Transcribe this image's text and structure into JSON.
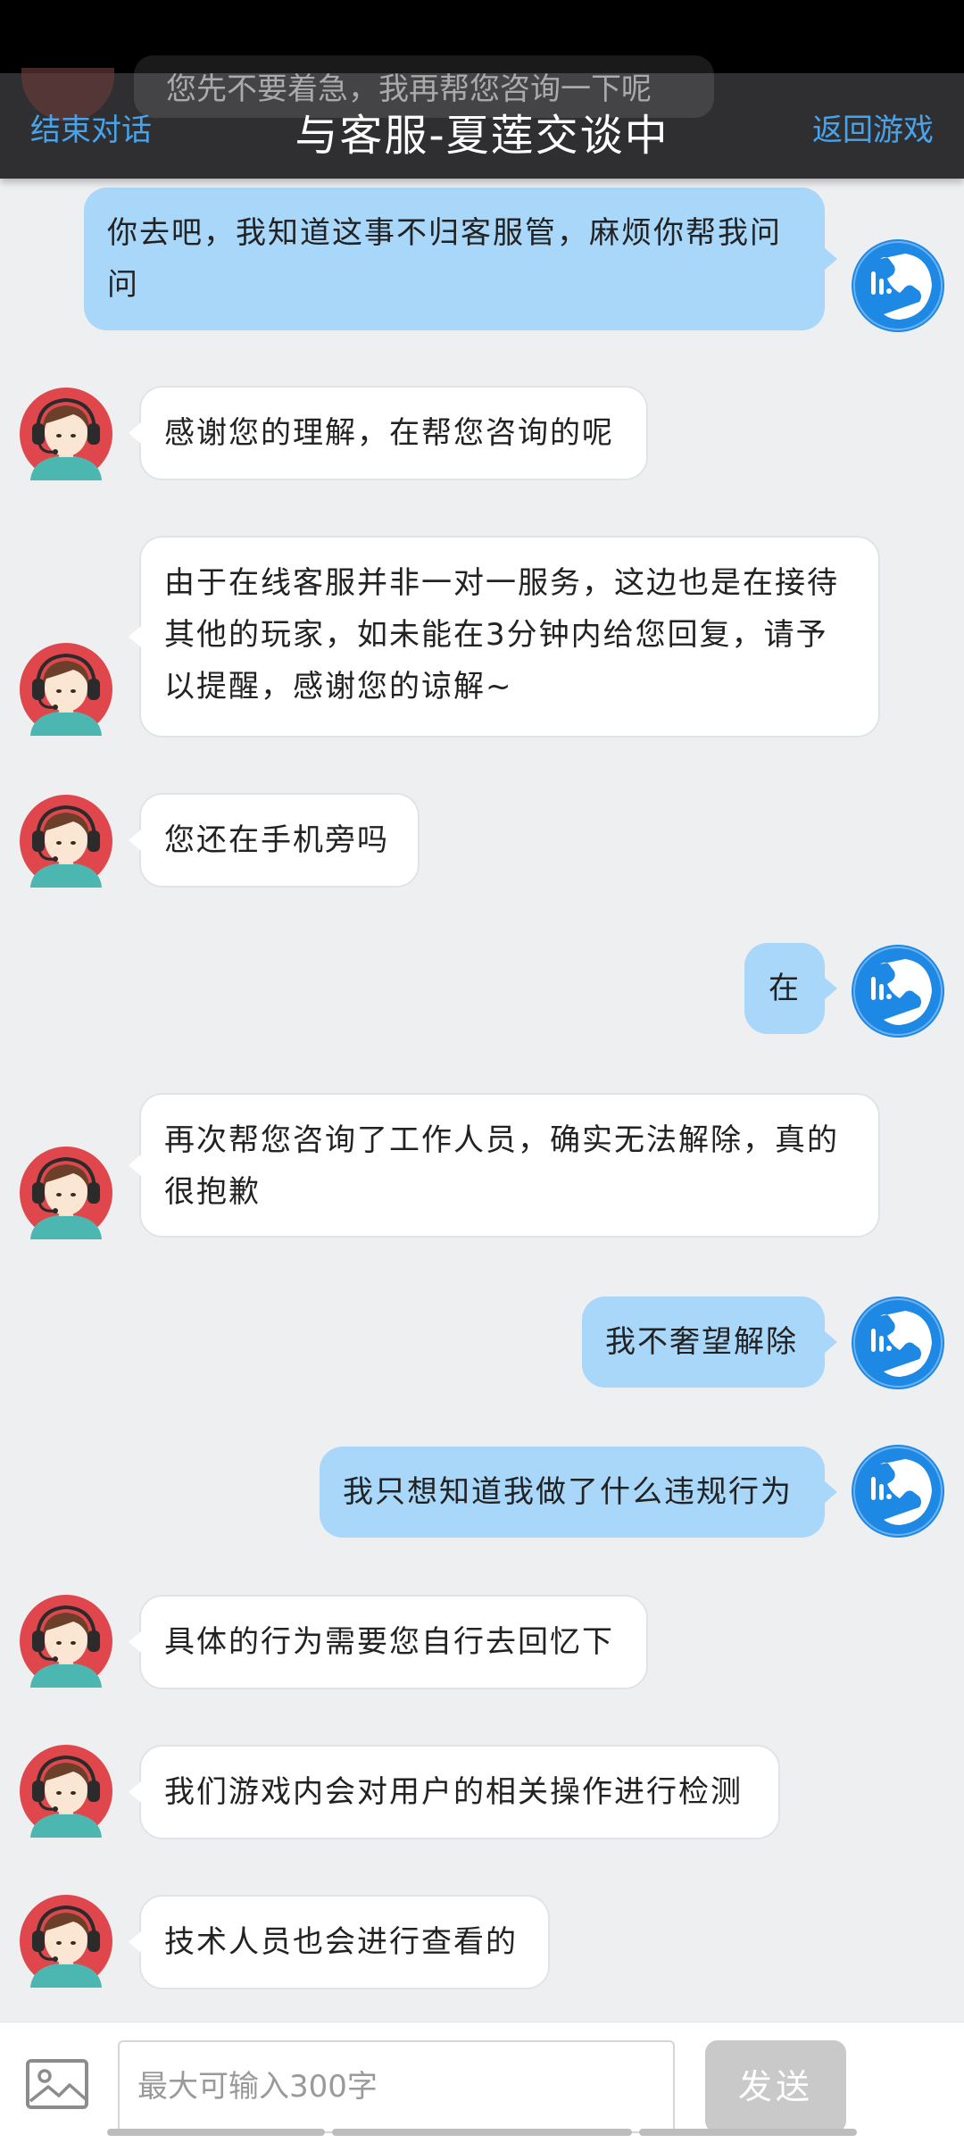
{
  "header": {
    "ghost_text": "您先不要着急，我再帮您咨询一下呢",
    "left_action": "结束对话",
    "title": "与客服-夏莲交谈中",
    "right_action": "返回游戏"
  },
  "messages": [
    {
      "sender": "user",
      "lines": [
        "你去吧，我知道这事不归客服管，麻烦你帮我问",
        "问"
      ]
    },
    {
      "sender": "agent",
      "lines": [
        "感谢您的理解，在帮您咨询的呢"
      ]
    },
    {
      "sender": "agent",
      "lines": [
        "由于在线客服并非一对一服务，这边也是在接待",
        "其他的玩家，如未能在3分钟内给您回复，请予",
        "以提醒，感谢您的谅解~"
      ]
    },
    {
      "sender": "agent",
      "lines": [
        "您还在手机旁吗"
      ]
    },
    {
      "sender": "user",
      "lines": [
        "在"
      ]
    },
    {
      "sender": "agent",
      "lines": [
        "再次帮您咨询了工作人员，确实无法解除，真的",
        "很抱歉"
      ]
    },
    {
      "sender": "user",
      "lines": [
        "我不奢望解除"
      ]
    },
    {
      "sender": "user",
      "lines": [
        "我只想知道我做了什么违规行为"
      ]
    },
    {
      "sender": "agent",
      "lines": [
        "具体的行为需要您自行去回忆下"
      ]
    },
    {
      "sender": "agent",
      "lines": [
        "我们游戏内会对用户的相关操作进行检测"
      ]
    },
    {
      "sender": "agent",
      "lines": [
        "技术人员也会进行查看的"
      ]
    }
  ],
  "input": {
    "placeholder": "最大可输入300字",
    "send_label": "发送"
  },
  "icons": {
    "agent_avatar": "customer-service-agent-avatar",
    "user_avatar": "phone-app-avatar",
    "image_button": "image-icon"
  },
  "colors": {
    "header_bg": "#2f2f31",
    "header_link": "#49a3ea",
    "user_bubble": "#a9d7f9",
    "agent_bubble": "#ffffff",
    "avatar_red": "#e0474c",
    "avatar_teal": "#4bb7b0",
    "user_avatar_blue": "#1e88e5",
    "send_disabled": "#c9c9c9"
  }
}
